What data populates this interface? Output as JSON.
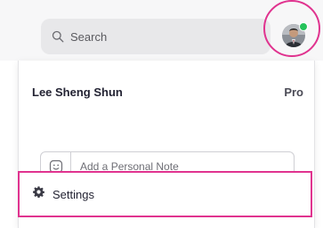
{
  "search": {
    "label": "Search",
    "icon": "search-icon"
  },
  "profile": {
    "name": "Lee Sheng Shun",
    "plan": "Pro",
    "status_color": "#24c25a",
    "highlight_color": "#e0338f"
  },
  "note": {
    "placeholder": "Add a Personal Note",
    "icon": "smiley-icon"
  },
  "menu": {
    "settings_label": "Settings",
    "settings_icon": "gear-icon"
  }
}
